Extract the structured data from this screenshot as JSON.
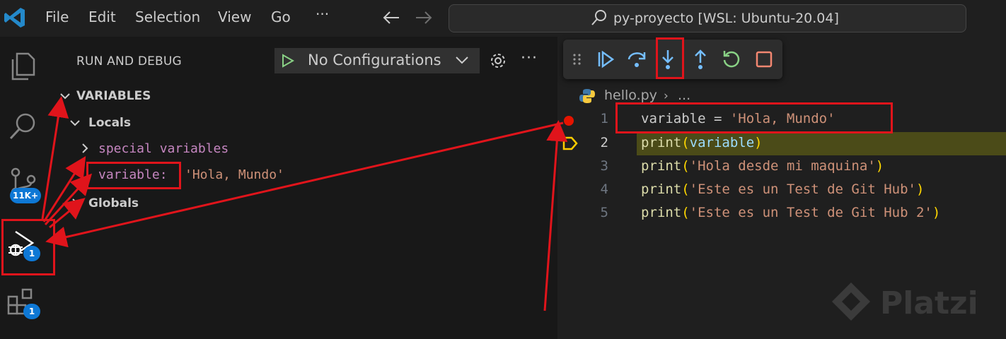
{
  "titlebar": {
    "menu": [
      "File",
      "Edit",
      "Selection",
      "View",
      "Go",
      "···"
    ],
    "search_text": "py-proyecto [WSL: Ubuntu-20.04]"
  },
  "activity": {
    "scm_badge": "11K+",
    "debug_badge": "1",
    "extensions_badge": "1"
  },
  "sidebar": {
    "title": "RUN AND DEBUG",
    "config_label": "No Configurations",
    "section": "VARIABLES",
    "locals": "Locals",
    "special": "special variables",
    "var_name": "variable:",
    "var_value": "'Hola, Mundo'",
    "globals": "Globals"
  },
  "editor": {
    "filename": "hello.py",
    "crumb_more": "...",
    "lines": [
      {
        "num": "1",
        "parts": [
          [
            "variable = ",
            "c-default"
          ],
          [
            "'Hola, Mundo'",
            "c-str"
          ]
        ]
      },
      {
        "num": "2",
        "parts": [
          [
            "print",
            "c-fn"
          ],
          [
            "(",
            "c-paren"
          ],
          [
            "variable",
            "c-var"
          ],
          [
            ")",
            "c-paren"
          ]
        ]
      },
      {
        "num": "3",
        "parts": [
          [
            "print",
            "c-fn"
          ],
          [
            "(",
            "c-paren"
          ],
          [
            "'Hola desde mi maquina'",
            "c-str"
          ],
          [
            ")",
            "c-paren"
          ]
        ]
      },
      {
        "num": "4",
        "parts": [
          [
            "print",
            "c-fn"
          ],
          [
            "(",
            "c-paren"
          ],
          [
            "'Este es un Test de Git Hub'",
            "c-str"
          ],
          [
            ")",
            "c-paren"
          ]
        ]
      },
      {
        "num": "5",
        "parts": [
          [
            "print",
            "c-fn"
          ],
          [
            "(",
            "c-paren"
          ],
          [
            "'Este es un Test de Git Hub 2'",
            "c-str"
          ],
          [
            ")",
            "c-paren"
          ]
        ]
      }
    ]
  },
  "watermark": "Platzi",
  "colors": {
    "accent": "#0e78d5",
    "annotation": "#e0141b",
    "current_line": "#4b4b18",
    "breakpoint": "#e51400"
  },
  "debug_toolbar": [
    "gripper-icon",
    "continue-icon",
    "step-over-icon",
    "step-into-icon",
    "step-out-icon",
    "restart-icon",
    "stop-icon"
  ]
}
